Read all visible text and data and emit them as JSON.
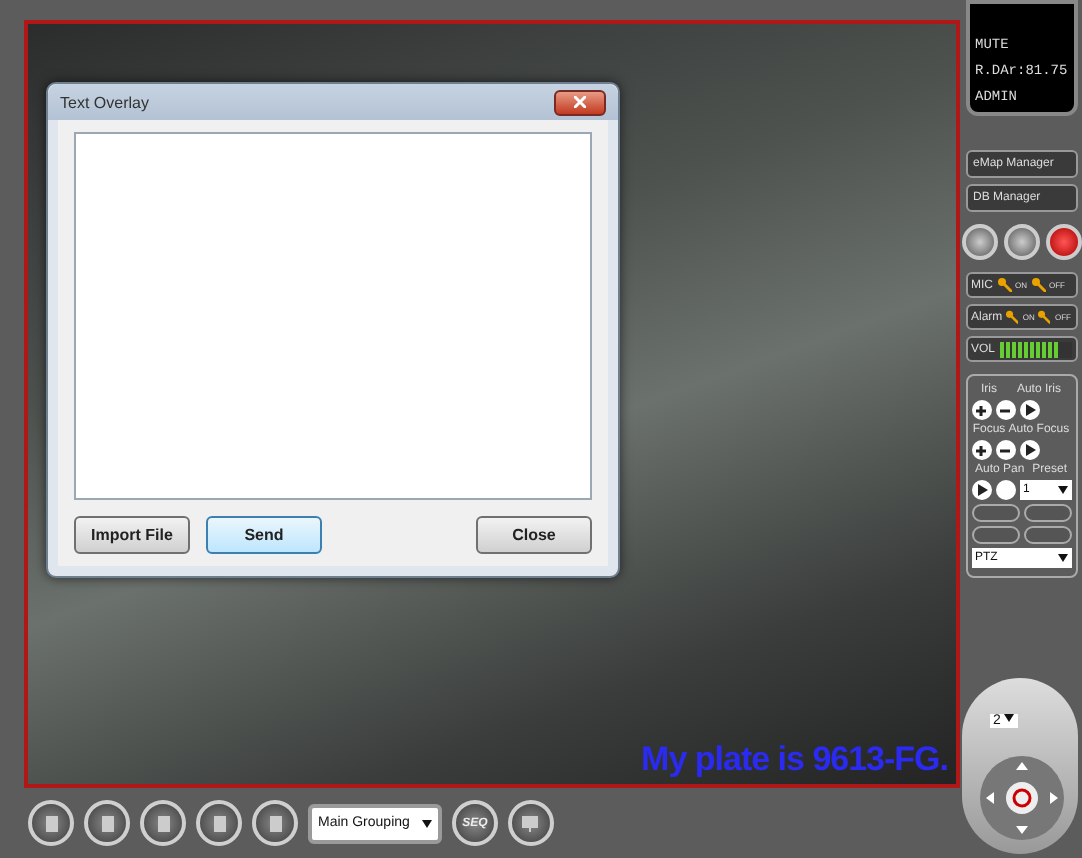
{
  "video": {
    "overlay_text": "My plate is 9613-FG."
  },
  "dialog": {
    "title": "Text Overlay",
    "buttons": [
      {
        "label": "Import File",
        "focused": false
      },
      {
        "label": "Send",
        "focused": true
      },
      {
        "label": "Close",
        "focused": false
      }
    ]
  },
  "toolbar": {
    "group_select": "Main Grouping",
    "seq_label": "SEQ"
  },
  "status_display": {
    "lines": [
      "MUTE",
      "R.DAr:81.75",
      "ADMIN"
    ]
  },
  "manager_buttons": [
    {
      "label": "eMap Manager"
    },
    {
      "label": "DB Manager"
    }
  ],
  "toggles": [
    {
      "label": "MIC",
      "on_label": "ON",
      "off_label": "OFF"
    },
    {
      "label": "Alarm",
      "on_label": "ON",
      "off_label": "OFF"
    }
  ],
  "volume": {
    "label": "VOL",
    "level": 0.85
  },
  "iris": {
    "label": "Iris",
    "auto_label": "Auto Iris"
  },
  "focus": {
    "label": "Focus",
    "auto_label": "Auto Focus"
  },
  "auto_pan": {
    "label": "Auto Pan"
  },
  "preset": {
    "label": "Preset",
    "value": "1"
  },
  "mode_select": {
    "value": "PTZ"
  },
  "ptz_pad": {
    "speed": "2"
  }
}
